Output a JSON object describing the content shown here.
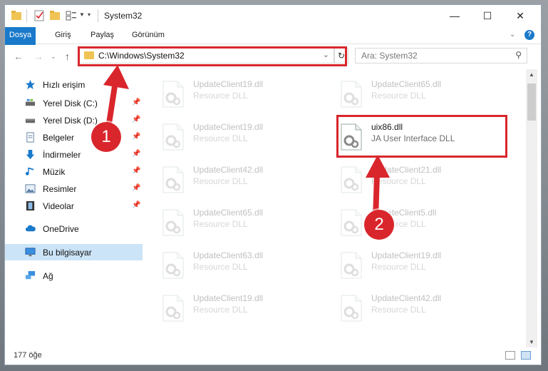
{
  "window": {
    "title": "System32"
  },
  "ribbon": {
    "tabs": [
      "Dosya",
      "Giriş",
      "Paylaş",
      "Görünüm"
    ]
  },
  "address": {
    "path": "C:\\Windows\\System32"
  },
  "search": {
    "placeholder": "Ara: System32"
  },
  "sidebar": {
    "items": [
      {
        "label": "Hızlı erişim",
        "icon": "star-icon",
        "pinned": false
      },
      {
        "label": "Yerel Disk (C:)",
        "icon": "drive-icon",
        "pinned": true
      },
      {
        "label": "Yerel Disk (D:)",
        "icon": "drive-icon",
        "pinned": true
      },
      {
        "label": "Belgeler",
        "icon": "document-icon",
        "pinned": true
      },
      {
        "label": "İndirmeler",
        "icon": "download-icon",
        "pinned": true
      },
      {
        "label": "Müzik",
        "icon": "music-icon",
        "pinned": true
      },
      {
        "label": "Resimler",
        "icon": "picture-icon",
        "pinned": true
      },
      {
        "label": "Videolar",
        "icon": "film-icon",
        "pinned": true
      },
      {
        "label": "OneDrive",
        "icon": "cloud-icon",
        "pinned": false
      },
      {
        "label": "Bu bilgisayar",
        "icon": "computer-icon",
        "pinned": false,
        "selected": true
      },
      {
        "label": "Ağ",
        "icon": "network-icon",
        "pinned": false
      }
    ]
  },
  "files": {
    "col1": [
      {
        "name": "UpdateClient19.dll",
        "desc": "Resource DLL"
      },
      {
        "name": "UpdateClient19.dll",
        "desc": "Resource DLL"
      },
      {
        "name": "UpdateClient42.dll",
        "desc": "Resource DLL"
      },
      {
        "name": "UpdateClient65.dll",
        "desc": "Resource DLL"
      },
      {
        "name": "UpdateClient63.dll",
        "desc": "Resource DLL"
      },
      {
        "name": "UpdateClient19.dll",
        "desc": "Resource DLL"
      }
    ],
    "col2": [
      {
        "name": "UpdateClient65.dll",
        "desc": "Resource DLL"
      },
      {
        "name": "uix86.dll",
        "desc": "JA User Interface DLL",
        "highlighted": true
      },
      {
        "name": "UpdateClient21.dll",
        "desc": "Resource DLL"
      },
      {
        "name": "UpdateClient5.dll",
        "desc": "Resource DLL"
      },
      {
        "name": "UpdateClient19.dll",
        "desc": "Resource DLL"
      },
      {
        "name": "UpdateClient42.dll",
        "desc": "Resource DLL"
      }
    ]
  },
  "status": {
    "count": "177 öğe"
  },
  "annotations": {
    "step1": "1",
    "step2": "2"
  },
  "colors": {
    "accent": "#1979ca",
    "highlight": "#d9262c",
    "selected": "#cce4f7"
  }
}
